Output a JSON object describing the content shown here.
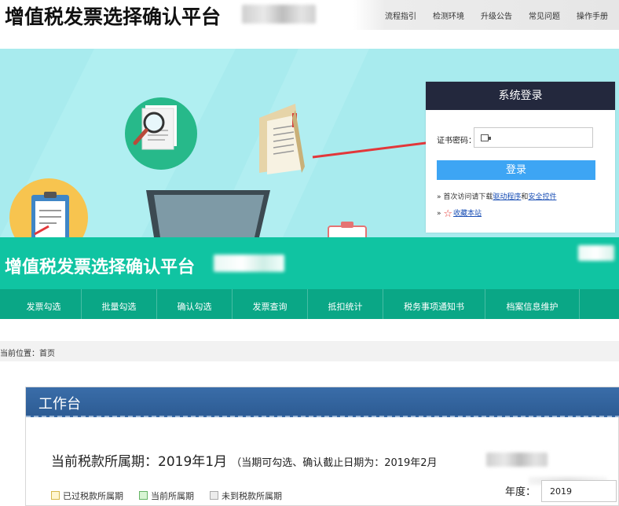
{
  "header": {
    "title": "增值税发票选择确认平台",
    "nav": [
      "流程指引",
      "检测环境",
      "升级公告",
      "常见问题",
      "操作手册"
    ]
  },
  "login": {
    "title": "系统登录",
    "password_label": "证书密码：",
    "password_value": "",
    "login_button": "登录",
    "note1_prefix": "首次访问请下载",
    "note1_link1": "驱动程序",
    "note1_and": "和",
    "note1_link2": "安全控件",
    "note2_link": "收藏本站"
  },
  "banner": {
    "title": "增值税发票选择确认平台",
    "nav": [
      "发票勾选",
      "批量勾选",
      "确认勾选",
      "发票查询",
      "抵扣统计",
      "税务事项通知书",
      "档案信息维护"
    ]
  },
  "breadcrumb": {
    "text": "当前位置：首页"
  },
  "workbench": {
    "title": "工作台",
    "period_main": "当前税款所属期：2019年1月",
    "period_sub": "（当期可勾选、确认截止日期为：2019年2月",
    "legend": [
      "已过税款所属期",
      "当前所属期",
      "未到税款所属期"
    ],
    "year_label": "年度：",
    "year_value": "2019"
  },
  "colors": {
    "hero_bg": "#a8ebee",
    "login_head": "#23283d",
    "login_button": "#3da5f4",
    "banner_green": "#10c4a2",
    "panel_head_blue": "#3a6da9"
  },
  "icons": [
    "search-document-icon",
    "folder-icon",
    "clipboard-icon",
    "laptop-icon",
    "red-arrow-annotation",
    "key-icon",
    "star-icon"
  ]
}
